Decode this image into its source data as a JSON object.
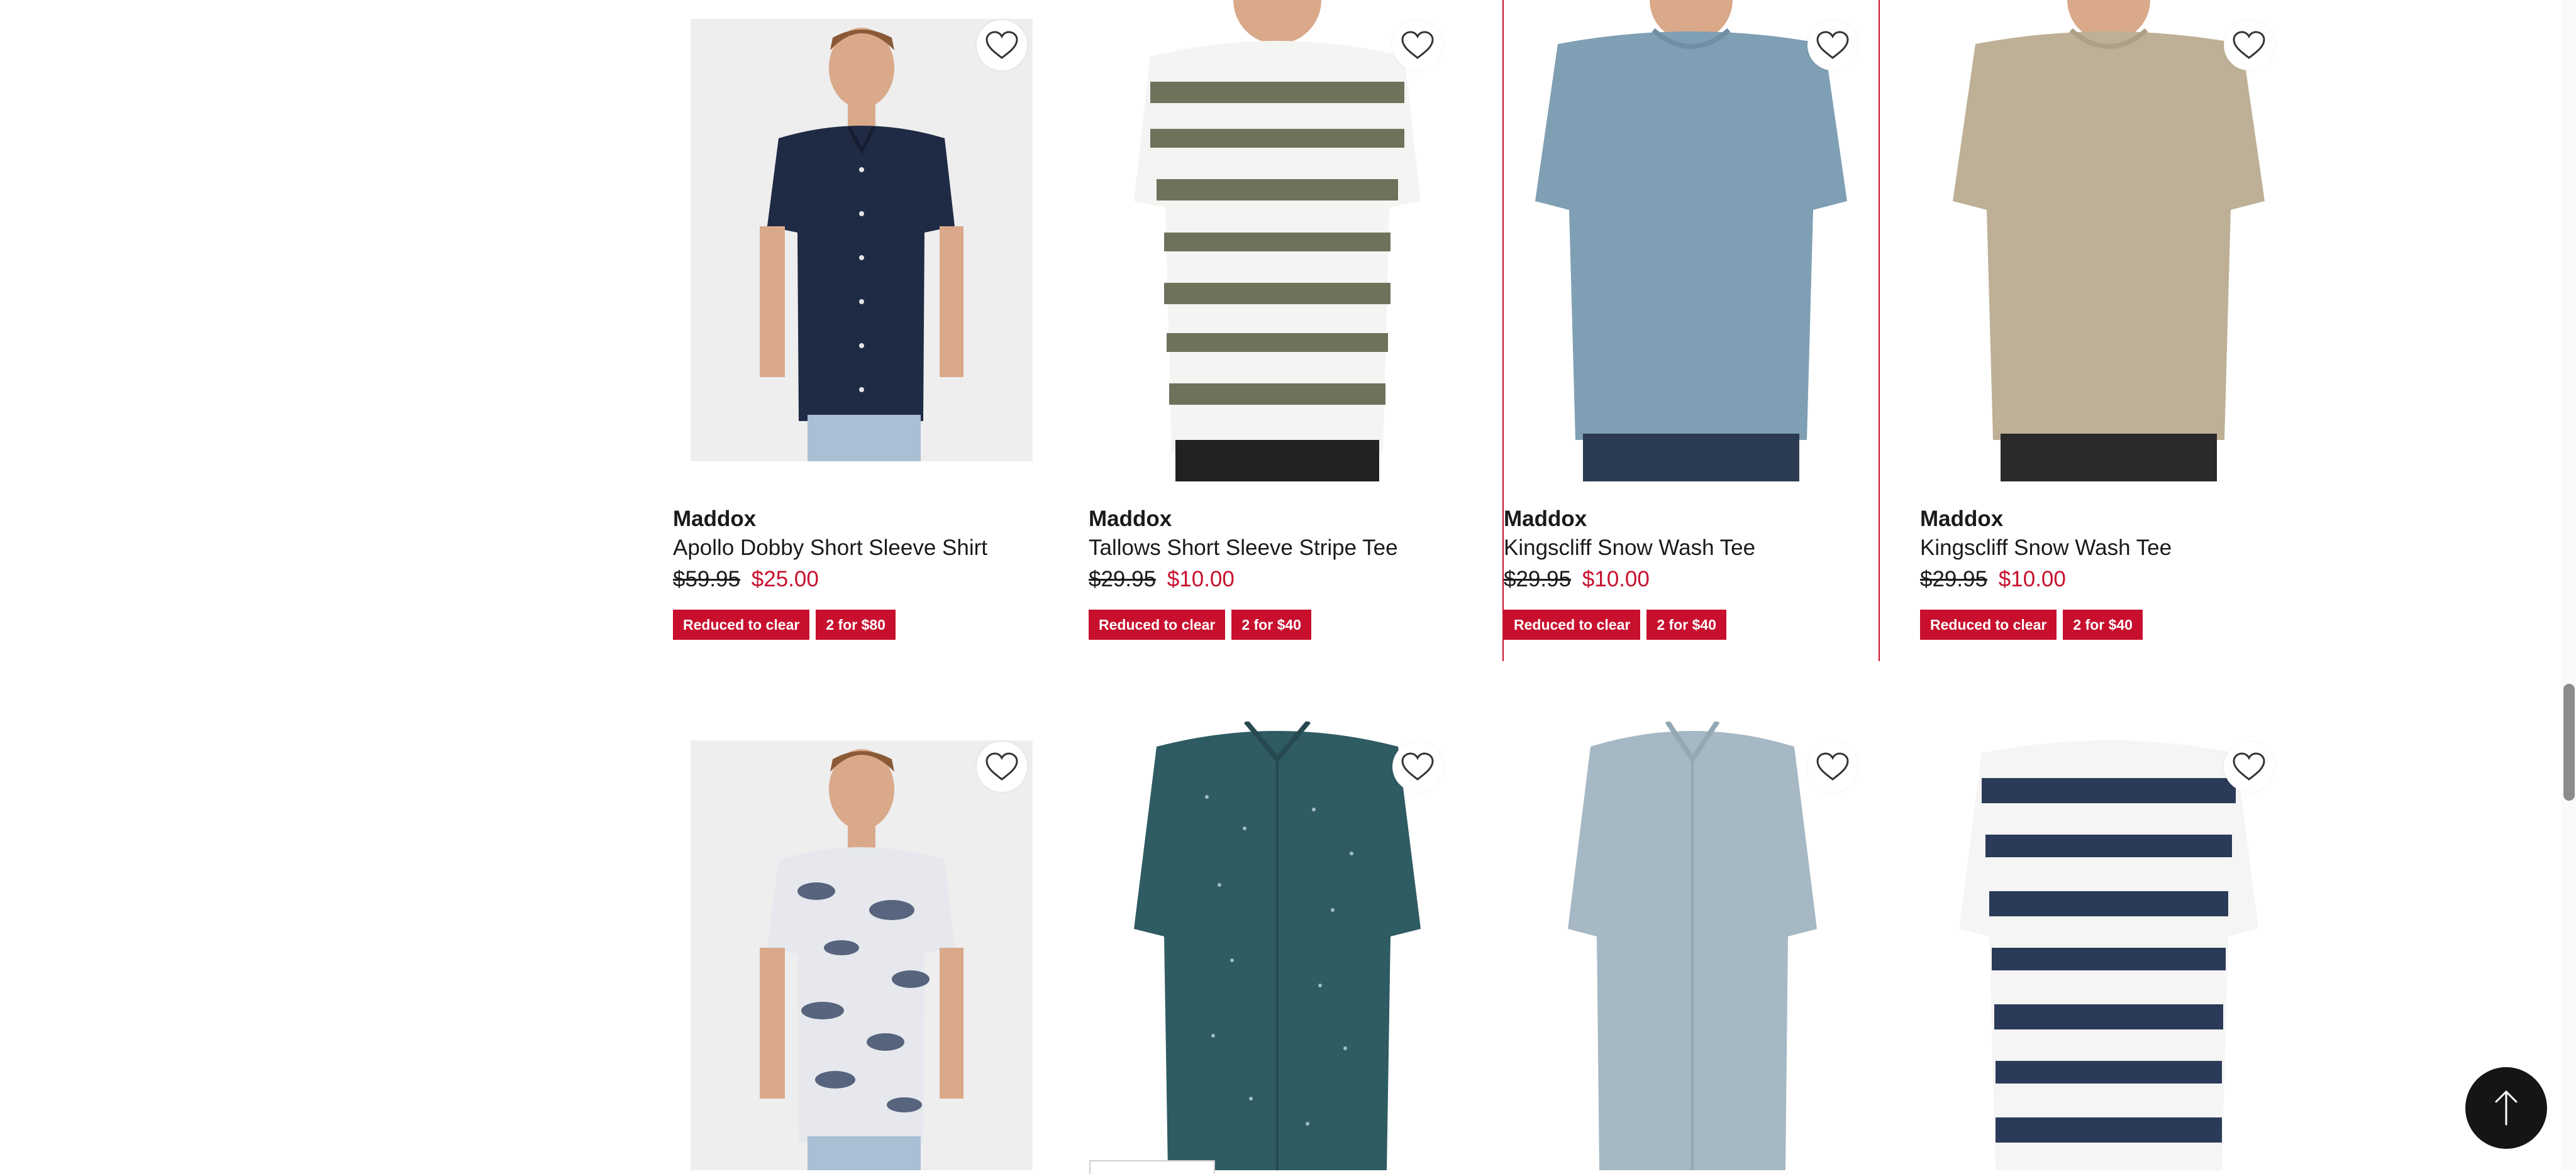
{
  "colors": {
    "accent": "#c8102e",
    "text": "#1a1a1a",
    "back_to_top_bg": "#151515"
  },
  "icons": {
    "favourite": "heart-outline-icon",
    "back_to_top": "arrow-up-icon"
  },
  "products": [
    {
      "brand": "Maddox",
      "title": "Apollo Dobby Short Sleeve Shirt",
      "was_price": "$59.95",
      "now_price": "$25.00",
      "badges": [
        "Reduced to clear",
        "2 for $80"
      ],
      "image": "navy dobby short sleeve shirt"
    },
    {
      "brand": "Maddox",
      "title": "Tallows Short Sleeve Stripe Tee",
      "was_price": "$29.95",
      "now_price": "$10.00",
      "badges": [
        "Reduced to clear",
        "2 for $40"
      ],
      "image": "olive and white stripe tee"
    },
    {
      "brand": "Maddox",
      "title": "Kingscliff Snow Wash Tee",
      "was_price": "$29.95",
      "now_price": "$10.00",
      "badges": [
        "Reduced to clear",
        "2 for $40"
      ],
      "image": "blue snow wash tee"
    },
    {
      "brand": "Maddox",
      "title": "Kingscliff Snow Wash Tee",
      "was_price": "$29.95",
      "now_price": "$10.00",
      "badges": [
        "Reduced to clear",
        "2 for $40"
      ],
      "image": "beige snow wash tee"
    },
    {
      "image": "white floral print shirt"
    },
    {
      "image": "teal dot print shirt"
    },
    {
      "image": "light blue short sleeve shirt"
    },
    {
      "image": "navy and white stripe tee"
    }
  ]
}
